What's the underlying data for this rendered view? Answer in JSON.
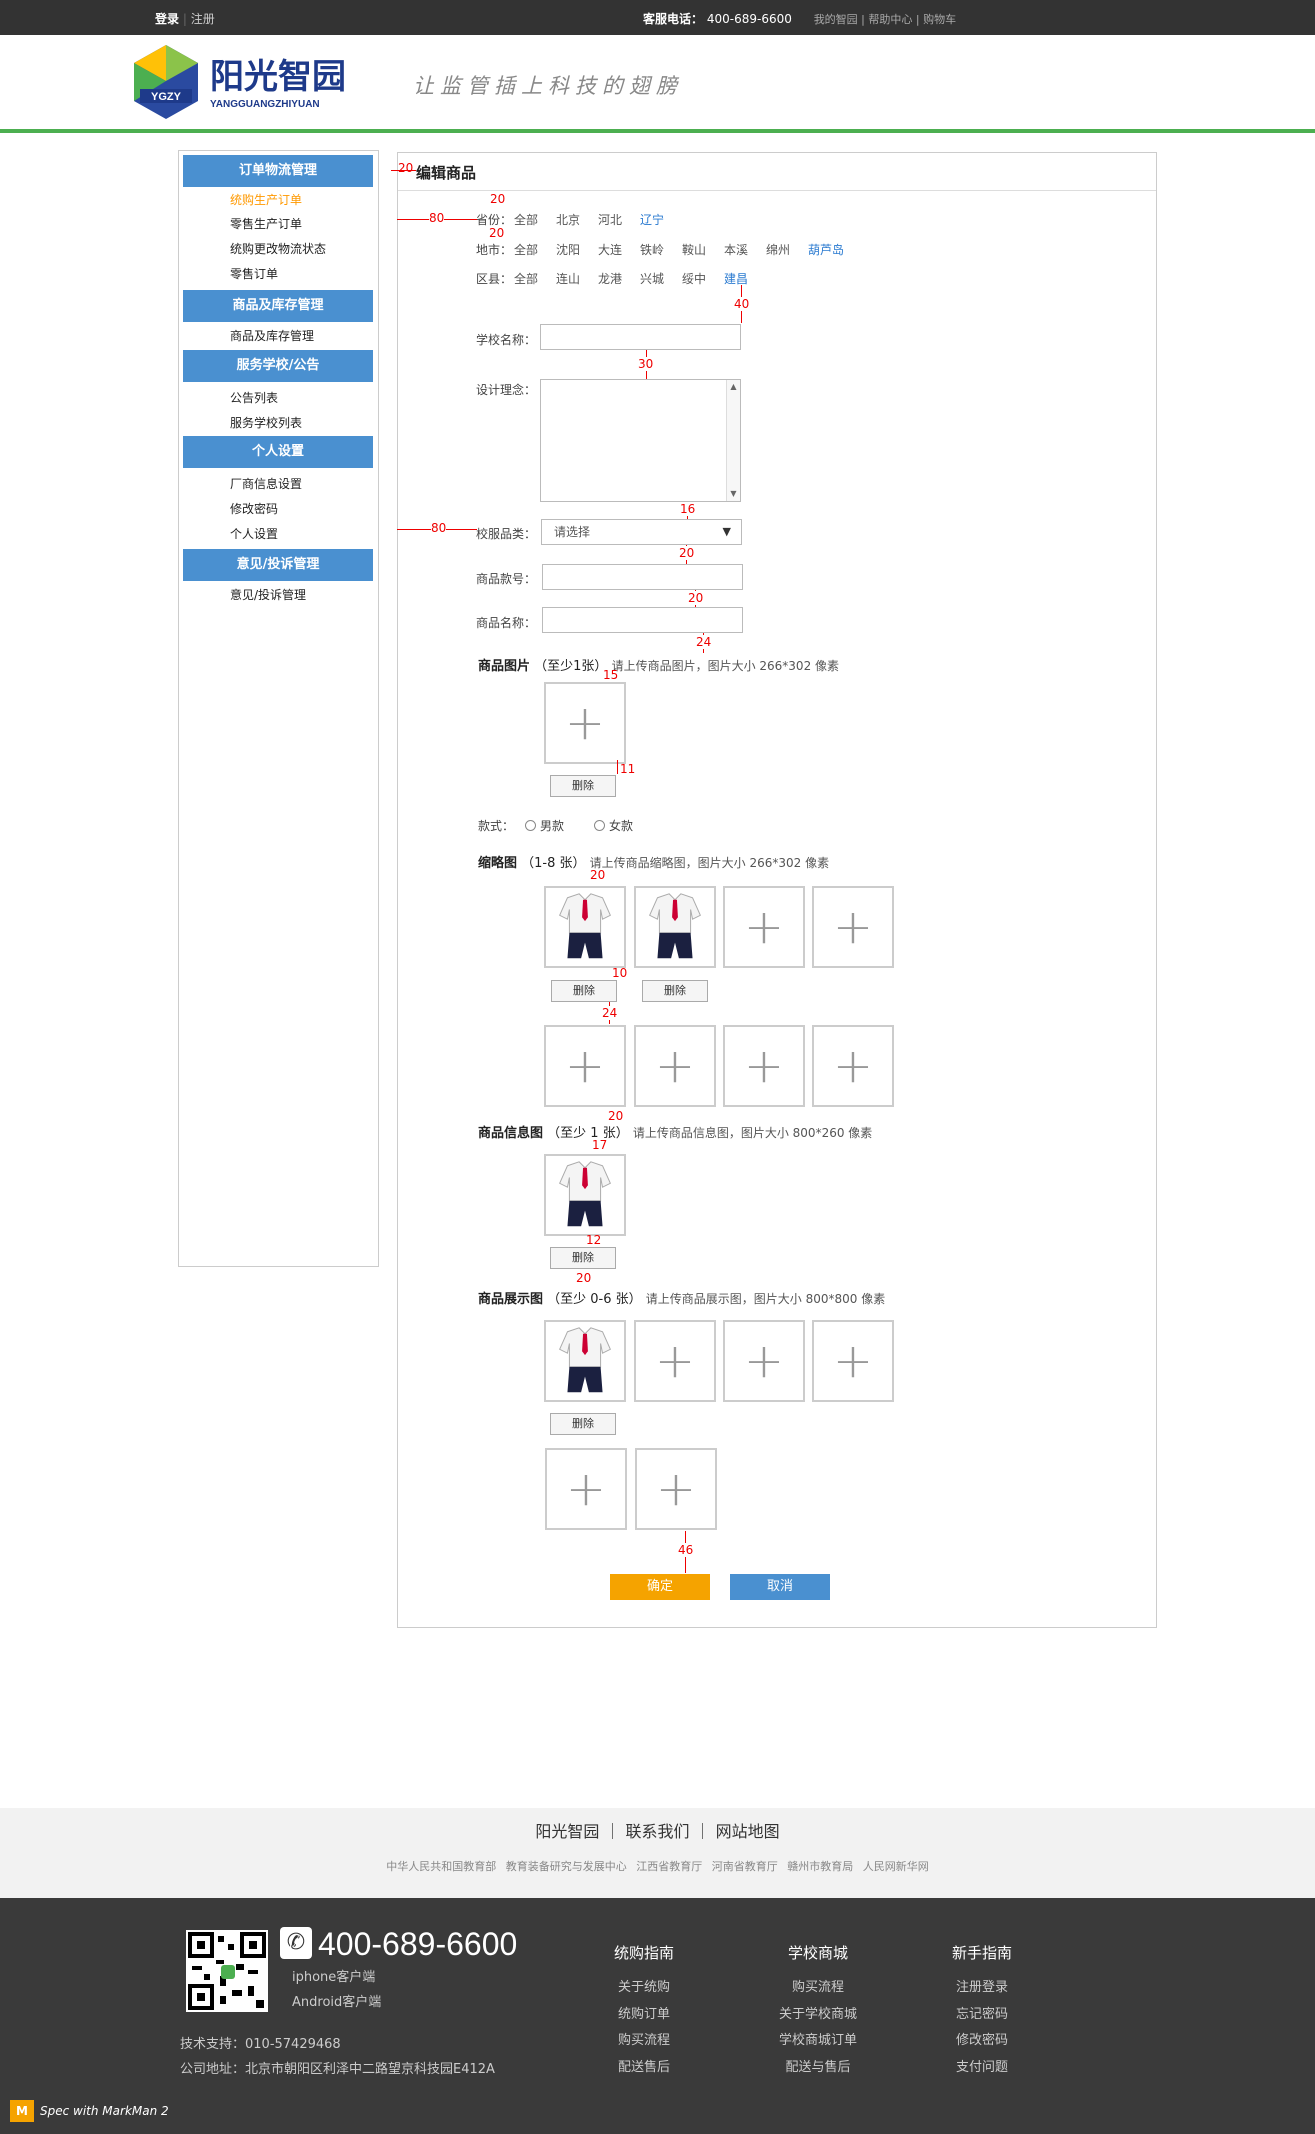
{
  "topbar": {
    "login": "登录",
    "register": "注册",
    "phone_label": "客服电话：",
    "phone": "400-689-6600",
    "links": "我的智园 | 帮助中心 | 购物车"
  },
  "header": {
    "logo_cn": "阳光智园",
    "logo_en": "YANGGUANGZHIYUAN",
    "logo_badge": "YGZY",
    "slogan": "让监管插上科技的翅膀"
  },
  "sidebar": {
    "groups": [
      {
        "title": "订单物流管理",
        "items": [
          "统购生产订单",
          "零售生产订单",
          "统购更改物流状态",
          "零售订单"
        ]
      },
      {
        "title": "商品及库存管理",
        "items": [
          "商品及库存管理"
        ]
      },
      {
        "title": "服务学校/公告",
        "items": [
          "公告列表",
          "服务学校列表"
        ]
      },
      {
        "title": "个人设置",
        "items": [
          "厂商信息设置",
          "修改密码",
          "个人设置"
        ]
      },
      {
        "title": "意见/投诉管理",
        "items": [
          "意见/投诉管理"
        ]
      }
    ]
  },
  "main": {
    "title": "编辑商品",
    "province": {
      "label": "省份：",
      "options": [
        "全部",
        "北京",
        "河北",
        "辽宁"
      ],
      "selected": "辽宁"
    },
    "city": {
      "label": "地市：",
      "options": [
        "全部",
        "沈阳",
        "大连",
        "铁岭",
        "鞍山",
        "本溪",
        "绵州",
        "葫芦岛"
      ],
      "selected": "葫芦岛"
    },
    "district": {
      "label": "区县：",
      "options": [
        "全部",
        "连山",
        "龙港",
        "兴城",
        "绥中",
        "建昌"
      ],
      "selected": "建昌"
    },
    "school_name_label": "学校名称：",
    "design_label": "设计理念：",
    "category_label": "校服品类：",
    "category_value": "请选择",
    "item_no_label": "商品款号：",
    "item_name_label": "商品名称：",
    "image_section": {
      "title": "商品图片",
      "count": "（至少1张）",
      "hint": "请上传商品图片，图片大小 266*302 像素"
    },
    "style_label": "款式：",
    "style_options": [
      "男款",
      "女款"
    ],
    "thumb_section": {
      "title": "缩略图",
      "count": "（1-8 张）",
      "hint": "请上传商品缩略图，图片大小 266*302 像素"
    },
    "info_section": {
      "title": "商品信息图",
      "count": "（至少 1 张）",
      "hint": "请上传商品信息图，图片大小 800*260 像素"
    },
    "display_section": {
      "title": "商品展示图",
      "count": "（至少 0-6 张）",
      "hint": "请上传商品展示图，图片大小 800*800 像素"
    },
    "delete_label": "删除",
    "confirm_label": "确定",
    "cancel_label": "取消"
  },
  "markers": {
    "m20a": "20",
    "m80a": "80",
    "m20b": "20",
    "m20c": "20",
    "m40": "40",
    "m30": "30",
    "m16": "16",
    "m80b": "80",
    "m20d": "20",
    "m20e": "20",
    "m24a": "24",
    "m15": "15",
    "m11": "11",
    "m20f": "20",
    "m10": "10",
    "m24b": "24",
    "m20g": "20",
    "m17": "17",
    "m12": "12",
    "m20h": "20",
    "m46": "46"
  },
  "footer": {
    "links_main": "阳光智园 ｜ 联系我们 ｜ 网站地图",
    "links_sub": "中华人民共和国教育部 教育装备研究与发展中心 江西省教育厅 河南省教育厅 赣州市教育局 人民网新华网",
    "phone": "400-689-6600",
    "client_ios": "iphone客户端",
    "client_android": "Android客户端",
    "support": "技术支持：010-57429468",
    "address": "公司地址：北京市朝阳区利泽中二路望京科技园E412A",
    "cols": [
      {
        "title": "统购指南",
        "items": [
          "关于统购",
          "统购订单",
          "购买流程",
          "配送售后"
        ]
      },
      {
        "title": "学校商城",
        "items": [
          "购买流程",
          "关于学校商城",
          "学校商城订单",
          "配送与售后"
        ]
      },
      {
        "title": "新手指南",
        "items": [
          "注册登录",
          "忘记密码",
          "修改密码",
          "支付问题"
        ]
      }
    ]
  },
  "markman": "Spec with MarkMan 2",
  "colors": {
    "accent": "#4a90d0",
    "green": "#4caf50",
    "orange": "#f5a300",
    "active": "#ff9900",
    "marker": "#ee0000"
  }
}
